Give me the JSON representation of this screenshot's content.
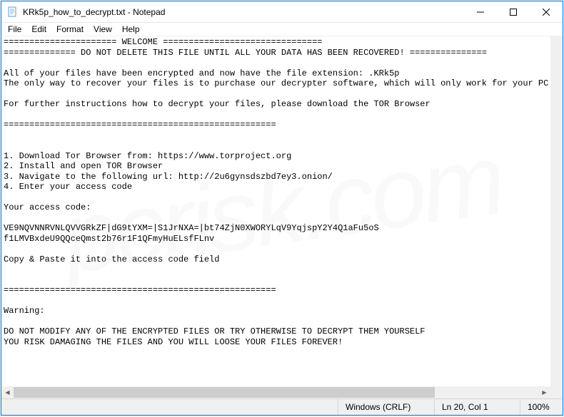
{
  "titlebar": {
    "title": "KRk5p_how_to_decrypt.txt - Notepad"
  },
  "menu": {
    "file": "File",
    "edit": "Edit",
    "format": "Format",
    "view": "View",
    "help": "Help"
  },
  "text": "====================== WELCOME ===============================\n============== DO NOT DELETE THIS FILE UNTIL ALL YOUR DATA HAS BEEN RECOVERED! ===============\n\nAll of your files have been encrypted and now have the file extension: .KRk5p\nThe only way to recover your files is to purchase our decrypter software, which will only work for your PC.\n\nFor further instructions how to decrypt your files, please download the TOR Browser\n\n=====================================================\n\n\n1. Download Tor Browser from: https://www.torproject.org\n2. Install and open TOR Browser\n3. Navigate to the following url: http://2u6gynsdszbd7ey3.onion/\n4. Enter your access code\n\nYour access code:\n\nVE9NQVNNRVNLQVVGRkZF|dG9tYXM=|S1JrNXA=|bt74ZjN0XWORYLqV9YqjspY2Y4Q1aFu5oS\nf1LMVBxdeU9QQceQmst2b76r1F1QFmyHuELsfFLnv\n\nCopy & Paste it into the access code field\n\n\n=====================================================\n\nWarning:\n\nDO NOT MODIFY ANY OF THE ENCRYPTED FILES OR TRY OTHERWISE TO DECRYPT THEM YOURSELF\nYOU RISK DAMAGING THE FILES AND YOU WILL LOOSE YOUR FILES FOREVER!\n",
  "status": {
    "encoding": "Windows (CRLF)",
    "position": "Ln 20, Col 1",
    "zoom": "100%"
  },
  "watermark": "pcrisk.com"
}
